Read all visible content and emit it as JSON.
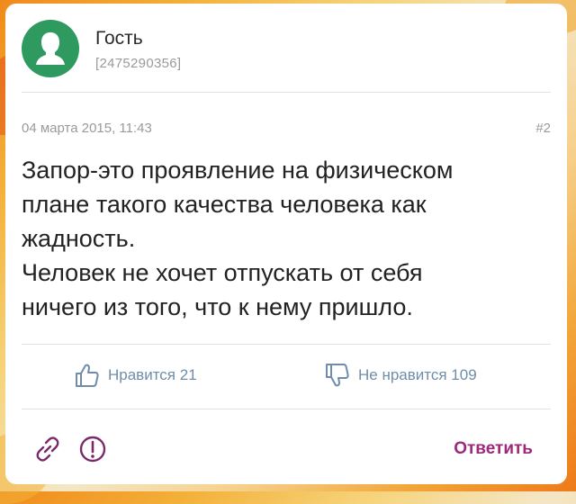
{
  "comment": {
    "author_name": "Гость",
    "author_id": "[2475290356]",
    "date": "04 марта 2015, 11:43",
    "number": "#2",
    "text_lines": [
      "Запор-это проявление на физическом",
      "плане такого качества человека как",
      "жадность.",
      "Человек не хочет отпускать от себя",
      "ничего из того, что к нему пришло."
    ]
  },
  "reactions": {
    "like_label": "Нравится 21",
    "dislike_label": "Не нравится 109"
  },
  "actions": {
    "reply_label": "Ответить"
  },
  "colors": {
    "avatar": "#2e9a5f",
    "reaction": "#6f8dab",
    "reply": "#a0287c"
  },
  "icons": {
    "like": "thumbs-up-icon",
    "dislike": "thumbs-down-icon",
    "link": "link-icon",
    "report": "exclamation-circle-icon",
    "avatar": "person-silhouette-icon"
  }
}
